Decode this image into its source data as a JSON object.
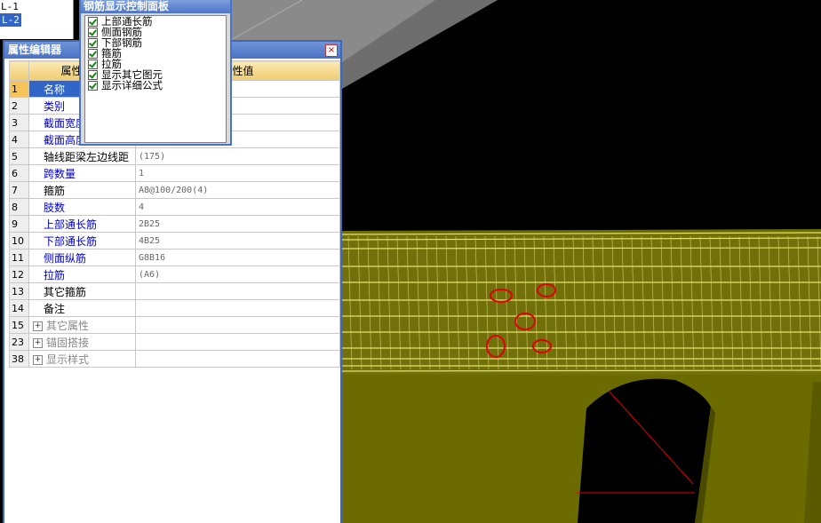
{
  "tree": {
    "items": [
      "L-1",
      "L-2"
    ]
  },
  "property_editor": {
    "title": "属性编辑器",
    "close_glyph": "×",
    "columns": {
      "name": "属性名称",
      "value": "属性值"
    },
    "rows": [
      {
        "num": "1",
        "name": "名称",
        "value": ""
      },
      {
        "num": "2",
        "name": "类别",
        "value": ""
      },
      {
        "num": "3",
        "name": "截面宽度",
        "value": ""
      },
      {
        "num": "4",
        "name": "截面高度",
        "value": ""
      },
      {
        "num": "5",
        "name": "轴线距梁左边线距",
        "value": "(175)"
      },
      {
        "num": "6",
        "name": "跨数量",
        "value": "1"
      },
      {
        "num": "7",
        "name": "箍筋",
        "value": "A8@100/200(4)"
      },
      {
        "num": "8",
        "name": "肢数",
        "value": "4"
      },
      {
        "num": "9",
        "name": "上部通长筋",
        "value": "2B25"
      },
      {
        "num": "10",
        "name": "下部通长筋",
        "value": "4B25"
      },
      {
        "num": "11",
        "name": "侧面纵筋",
        "value": "G8B16"
      },
      {
        "num": "12",
        "name": "拉筋",
        "value": "(A6)"
      },
      {
        "num": "13",
        "name": "其它箍筋",
        "value": ""
      },
      {
        "num": "14",
        "name": "备注",
        "value": ""
      },
      {
        "num": "15",
        "name": "其它属性",
        "value": ""
      },
      {
        "num": "23",
        "name": "锚固搭接",
        "value": ""
      },
      {
        "num": "38",
        "name": "显示样式",
        "value": ""
      }
    ]
  },
  "rebar_panel": {
    "title": "钢筋显示控制面板",
    "options": [
      {
        "label": "上部通长筋",
        "checked": true
      },
      {
        "label": "侧面钢筋",
        "checked": true
      },
      {
        "label": "下部钢筋",
        "checked": true
      },
      {
        "label": "箍筋",
        "checked": true
      },
      {
        "label": "拉筋",
        "checked": true
      },
      {
        "label": "显示其它图元",
        "checked": true
      },
      {
        "label": "显示详细公式",
        "checked": true
      }
    ]
  },
  "colors": {
    "beam": "#6b6b00",
    "rebar": "#e6e46a",
    "highlight": "#e00000",
    "background": "#000000",
    "selection": "#3165c8"
  }
}
